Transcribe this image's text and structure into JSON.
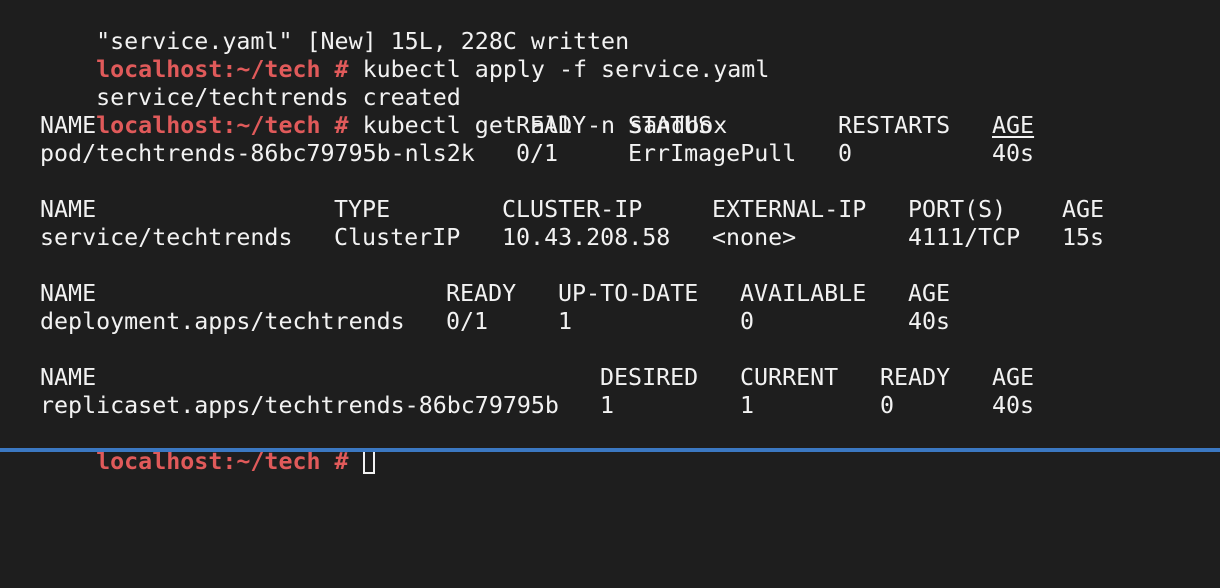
{
  "terminal": {
    "write_status": "\"service.yaml\" [New] 15L, 228C written",
    "prompt": "localhost:~/tech #",
    "commands": {
      "apply": " kubectl apply -f service.yaml",
      "get": " kubectl get all -n sandbox"
    },
    "apply_output": "service/techtrends created",
    "pods": {
      "headers": [
        "NAME",
        "READY",
        "STATUS",
        "RESTARTS",
        "AGE"
      ],
      "row": [
        "pod/techtrends-86bc79795b-nls2k",
        "0/1",
        "ErrImagePull",
        "0",
        "40s"
      ]
    },
    "services": {
      "headers": [
        "NAME",
        "TYPE",
        "CLUSTER-IP",
        "EXTERNAL-IP",
        "PORT(S)",
        "AGE"
      ],
      "row": [
        "service/techtrends",
        "ClusterIP",
        "10.43.208.58",
        "<none>",
        "4111/TCP",
        "15s"
      ]
    },
    "deployments": {
      "headers": [
        "NAME",
        "READY",
        "UP-TO-DATE",
        "AVAILABLE",
        "AGE"
      ],
      "row": [
        "deployment.apps/techtrends",
        "0/1",
        "1",
        "0",
        "40s"
      ]
    },
    "replicasets": {
      "headers": [
        "NAME",
        "DESIRED",
        "CURRENT",
        "READY",
        "AGE"
      ],
      "row": [
        "replicaset.apps/techtrends-86bc79795b",
        "1",
        "1",
        "0",
        "40s"
      ]
    },
    "colors": {
      "background": "#1e1e1e",
      "text": "#f2f2f2",
      "prompt": "#e05a5a",
      "accent_bar": "#3b78c2"
    }
  }
}
